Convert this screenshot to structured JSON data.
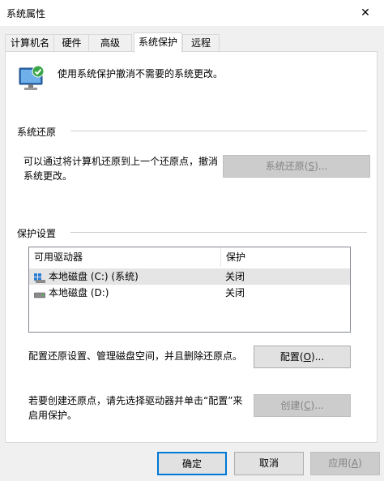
{
  "window": {
    "title": "系统属性",
    "close_glyph": "✕"
  },
  "tabs": [
    {
      "label": "计算机名"
    },
    {
      "label": "硬件"
    },
    {
      "label": "高级"
    },
    {
      "label": "系统保护"
    },
    {
      "label": "远程"
    }
  ],
  "active_tab": "系统保护",
  "intro": {
    "text": "使用系统保护撤消不需要的系统更改。",
    "icon": "system-protection-icon"
  },
  "restore": {
    "group_label": "系统还原",
    "description": "可以通过将计算机还原到上一个还原点，撤消系统更改。",
    "desc_line1": "可以通过将计算机还原到上一个还原点，撤消",
    "desc_line2": "系统更改。",
    "button": {
      "label": "系统还原",
      "accel": "S",
      "suffix": ")...",
      "enabled": false
    }
  },
  "protection": {
    "group_label": "保护设置",
    "columns": [
      "可用驱动器",
      "保护"
    ],
    "drives": [
      {
        "name": "本地磁盘 (C:) (系统)",
        "status": "关闭",
        "icon": "system-drive-icon",
        "selected": true
      },
      {
        "name": "本地磁盘 (D:)",
        "status": "关闭",
        "icon": "drive-icon",
        "selected": false
      }
    ],
    "configure_text": "配置还原设置、管理磁盘空间，并且删除还原点。",
    "configure_button": {
      "label": "配置",
      "accel": "O",
      "suffix": ")..."
    },
    "create_line1": "若要创建还原点，请先选择驱动器并单击“配置”来",
    "create_line2": "启用保护。",
    "create_button": {
      "label": "创建",
      "accel": "C",
      "suffix": ")...",
      "enabled": false
    }
  },
  "footer": {
    "ok": "确定",
    "cancel": "取消",
    "apply": {
      "label": "应用",
      "accel": "A",
      "suffix": ")",
      "enabled": false
    }
  },
  "colors": {
    "accent": "#0078d7",
    "window_bg": "#f0f0f0",
    "panel_bg": "#ffffff",
    "disabled_text": "#838383"
  }
}
